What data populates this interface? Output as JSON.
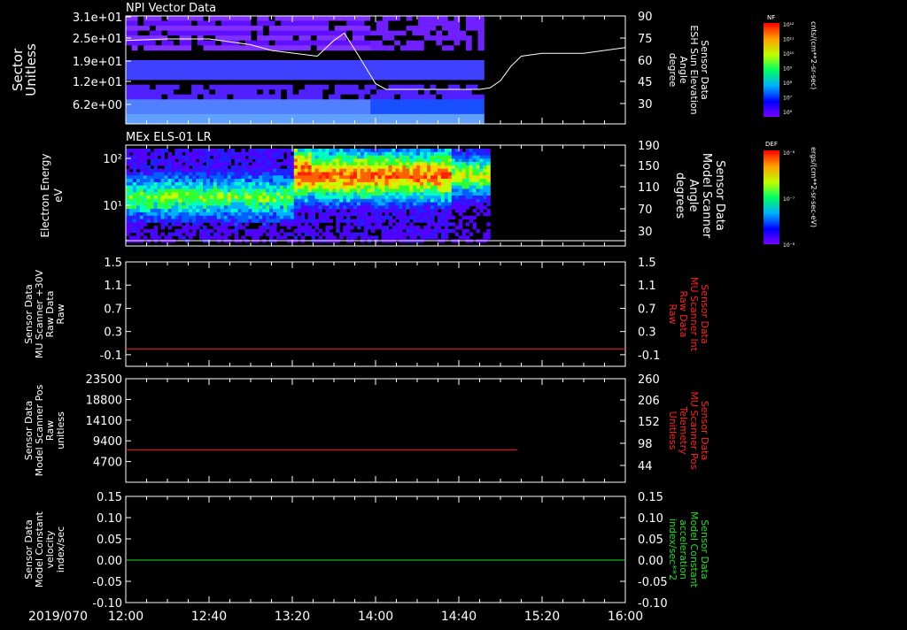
{
  "date_label": "2019/070",
  "x_axis": {
    "ticks": [
      "12:00",
      "12:40",
      "13:20",
      "14:00",
      "14:40",
      "15:20",
      "16:00"
    ]
  },
  "panels": [
    {
      "title": "NPI Vector Data"
    },
    {
      "title": "MEx ELS-01 LR"
    },
    {
      "title": ""
    },
    {
      "title": ""
    },
    {
      "title": ""
    }
  ],
  "colorbars": [
    {
      "label": "NF",
      "unit": "cnts/(cm**2-sr-sec)",
      "ticks": [
        "10¹²",
        "10¹¹",
        "10¹⁰",
        "10⁹",
        "10⁸",
        "10⁷",
        "10⁶"
      ]
    },
    {
      "label": "DEF",
      "unit": "ergs/(cm**2-sr-sec-eV)",
      "ticks": [
        "10⁻⁶",
        "10⁻⁷",
        "10⁻⁸"
      ]
    }
  ],
  "chart_data": [
    {
      "type": "heatmap",
      "title": "NPI Vector Data",
      "ylabel": [
        "Sector",
        "Unitless"
      ],
      "yticks": [
        "3.1e+01",
        "2.5e+01",
        "1.9e+01",
        "1.2e+01",
        "6.2e+00"
      ],
      "y2label": [
        "Sensor Data",
        "ESH Sun Elevation",
        "Angle",
        "degree"
      ],
      "y2ticks": [
        "90",
        "75",
        "60",
        "45",
        "30"
      ],
      "y2range": [
        15,
        90
      ],
      "overlay_line": {
        "color": "#ffffff",
        "x": [
          "12:00",
          "12:20",
          "12:40",
          "13:00",
          "13:10",
          "13:32",
          "13:40",
          "13:45",
          "13:52",
          "14:00",
          "14:05",
          "14:30",
          "14:50",
          "14:55",
          "15:00",
          "15:05",
          "15:10",
          "15:20",
          "15:40",
          "16:00"
        ],
        "y": [
          73,
          74,
          74,
          70,
          66,
          62,
          73,
          78,
          62,
          43,
          39,
          39,
          39,
          40,
          45,
          55,
          62,
          64,
          64,
          68
        ]
      },
      "data_end": "14:52"
    },
    {
      "type": "heatmap",
      "title": "MEx ELS-01 LR",
      "ylabel": [
        "Electron Energy",
        "eV"
      ],
      "yticks": [
        "10²",
        "10¹"
      ],
      "y2label": [
        "Sensor Data",
        "Model Scanner",
        "Angle",
        "degrees"
      ],
      "y2ticks": [
        "190",
        "150",
        "110",
        "70",
        "30"
      ],
      "y2range": [
        0,
        190
      ],
      "overlay_line": {
        "color": "#ffffff",
        "x": [
          "12:00",
          "16:00"
        ],
        "y": [
          10,
          10
        ]
      },
      "data_end": "14:55"
    },
    {
      "type": "line",
      "ylabel": [
        "Sensor Data",
        "MU Scanner +30V",
        "Raw Data",
        "Raw"
      ],
      "yticks": [
        "1.5",
        "1.1",
        "0.7",
        "0.3",
        "-0.1"
      ],
      "yrange": [
        -0.3,
        1.5
      ],
      "y2label": [
        "Sensor Data",
        "MU Scanner Int",
        "Raw Data",
        "Raw"
      ],
      "y2ticks": [
        "1.5",
        "1.1",
        "0.7",
        "0.3",
        "-0.1"
      ],
      "y2color": "#ff2020",
      "series": [
        {
          "color": "#ff2020",
          "x": [
            "12:00",
            "16:00"
          ],
          "y": [
            0.0,
            0.0
          ]
        }
      ]
    },
    {
      "type": "line",
      "ylabel": [
        "Sensor Data",
        "Model Scanner Pos",
        "Raw",
        "unitless"
      ],
      "yticks": [
        "23500",
        "18800",
        "14100",
        "9400",
        "4700"
      ],
      "yrange": [
        0,
        23500
      ],
      "y2label": [
        "Sensor Data",
        "MU Scanner Pos",
        "Telemetry",
        "Unitless"
      ],
      "y2ticks": [
        "260",
        "206",
        "152",
        "98",
        "44"
      ],
      "y2color": "#ff2020",
      "series": [
        {
          "color": "#ff2020",
          "x": [
            "12:00",
            "15:08"
          ],
          "y": [
            7400,
            7400
          ]
        }
      ]
    },
    {
      "type": "line",
      "ylabel": [
        "Sensor Data",
        "Model Constant",
        "velocity",
        "index/sec"
      ],
      "yticks": [
        "0.15",
        "0.10",
        "0.05",
        "0.00",
        "-0.05",
        "-0.10"
      ],
      "yrange": [
        -0.1,
        0.15
      ],
      "y2label": [
        "Sensor Data",
        "Model Constant",
        "acceleration",
        "index/sec**2"
      ],
      "y2ticks": [
        "0.15",
        "0.10",
        "0.05",
        "0.00",
        "-0.05",
        "-0.10"
      ],
      "y2color": "#22dd22",
      "series": [
        {
          "color": "#22dd22",
          "x": [
            "12:00",
            "16:00"
          ],
          "y": [
            0.0,
            0.0
          ]
        }
      ]
    }
  ]
}
